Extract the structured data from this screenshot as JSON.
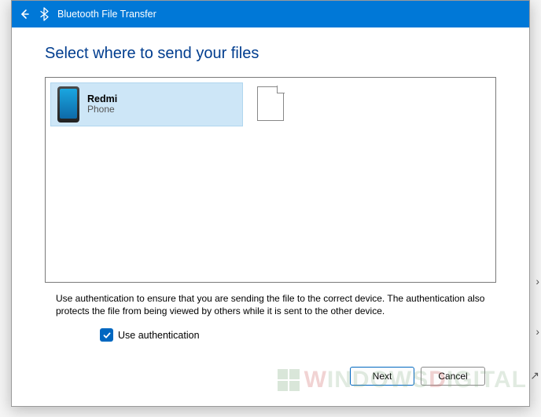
{
  "titlebar": {
    "title": "Bluetooth File Transfer"
  },
  "heading": "Select where to send your files",
  "device": {
    "name": "Redmi",
    "type": "Phone"
  },
  "description": "Use authentication to ensure that you are sending the file to the correct device. The authentication also protects the file from being viewed by others while it is sent to the other device.",
  "checkbox": {
    "label": "Use authentication",
    "checked": true
  },
  "buttons": {
    "next": "Next",
    "cancel": "Cancel"
  },
  "watermark": {
    "brand_w": "W",
    "brand_rest": "INDOWS",
    "brand_d": "D",
    "brand_rest2": "IGITAL"
  }
}
